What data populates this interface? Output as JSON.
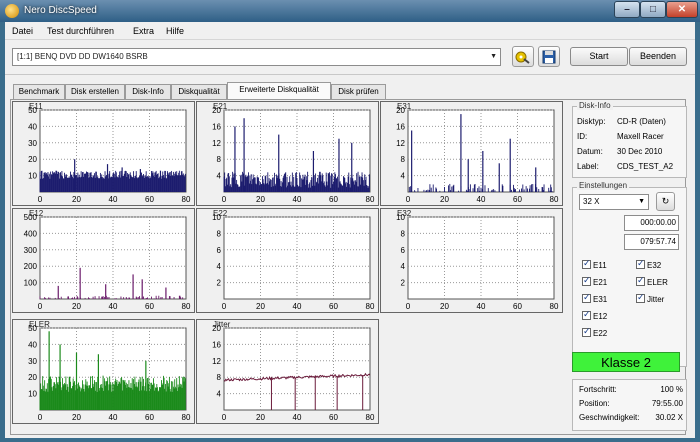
{
  "window": {
    "title": "Nero DiscSpeed",
    "min_glyph": "–",
    "max_glyph": "□",
    "close_glyph": "✕",
    "frame_color": "#3a6d8c"
  },
  "menu": [
    "Datei",
    "Test durchführen",
    "Extra",
    "Hilfe"
  ],
  "toolbar": {
    "drive": "[1:1]  BENQ DVD DD DW1640 BSRB",
    "start_label": "Start",
    "stop_label": "Beenden",
    "icon_names": [
      "drive-properties-icon",
      "save-icon"
    ]
  },
  "tabs": [
    "Benchmark",
    "Disk erstellen",
    "Disk-Info",
    "Diskqualität",
    "Erweiterte Diskqualität",
    "Disk prüfen"
  ],
  "active_tab": 4,
  "chart_data": [
    {
      "id": "e11",
      "type": "bar",
      "name": "E11",
      "color": "#1c1c6e",
      "ylim": [
        0,
        50
      ],
      "yticks": [
        10,
        20,
        30,
        40,
        50
      ],
      "xlim": [
        0,
        80
      ],
      "xticks": [
        0,
        20,
        40,
        60,
        80
      ],
      "base_level": 8,
      "level_variation": 5,
      "spikes": [
        [
          19,
          20
        ],
        [
          37,
          17
        ],
        [
          45,
          15
        ],
        [
          55,
          14
        ],
        [
          66,
          13
        ]
      ]
    },
    {
      "id": "e21",
      "type": "bar",
      "name": "E21",
      "color": "#1c1c6e",
      "ylim": [
        0,
        20
      ],
      "yticks": [
        4,
        8,
        12,
        16,
        20
      ],
      "xlim": [
        0,
        80
      ],
      "xticks": [
        0,
        20,
        40,
        60,
        80
      ],
      "base_level": 1,
      "level_variation": 4,
      "spikes": [
        [
          6,
          16
        ],
        [
          11,
          18
        ],
        [
          30,
          14
        ],
        [
          49,
          10
        ],
        [
          63,
          13
        ],
        [
          70,
          12
        ]
      ]
    },
    {
      "id": "e31",
      "type": "bar",
      "name": "E31",
      "color": "#1c1c6e",
      "ylim": [
        0,
        20
      ],
      "yticks": [
        4,
        8,
        12,
        16,
        20
      ],
      "xlim": [
        0,
        80
      ],
      "xticks": [
        0,
        20,
        40,
        60,
        80
      ],
      "base_level": 0,
      "level_variation": 2,
      "spikes": [
        [
          2,
          15
        ],
        [
          29,
          19
        ],
        [
          33,
          8
        ],
        [
          41,
          10
        ],
        [
          50,
          7
        ],
        [
          56,
          13
        ],
        [
          70,
          6
        ]
      ]
    },
    {
      "id": "e12",
      "type": "bar",
      "name": "E12",
      "color": "#6a1a6a",
      "ylim": [
        0,
        500
      ],
      "yticks": [
        100,
        200,
        300,
        400,
        500
      ],
      "xlim": [
        0,
        80
      ],
      "xticks": [
        0,
        20,
        40,
        60,
        80
      ],
      "base_level": 0,
      "level_variation": 20,
      "spikes": [
        [
          10,
          80
        ],
        [
          22,
          190
        ],
        [
          36,
          90
        ],
        [
          51,
          150
        ],
        [
          56,
          120
        ],
        [
          69,
          70
        ]
      ]
    },
    {
      "id": "e22",
      "type": "bar",
      "name": "E22",
      "color": "#6a1a6a",
      "ylim": [
        0,
        10
      ],
      "yticks": [
        2,
        4,
        6,
        8,
        10
      ],
      "xlim": [
        0,
        80
      ],
      "xticks": [
        0,
        20,
        40,
        60,
        80
      ],
      "base_level": 0,
      "level_variation": 0,
      "spikes": []
    },
    {
      "id": "e32",
      "type": "bar",
      "name": "E32",
      "color": "#6a1a6a",
      "ylim": [
        0,
        10
      ],
      "yticks": [
        2,
        4,
        6,
        8,
        10
      ],
      "xlim": [
        0,
        80
      ],
      "xticks": [
        0,
        20,
        40,
        60,
        80
      ],
      "base_level": 0,
      "level_variation": 0,
      "spikes": []
    },
    {
      "id": "eler",
      "type": "bar",
      "name": "ELER",
      "color": "#1b8a1b",
      "ylim": [
        0,
        50
      ],
      "yticks": [
        10,
        20,
        30,
        40,
        50
      ],
      "xlim": [
        0,
        80
      ],
      "xticks": [
        0,
        20,
        40,
        60,
        80
      ],
      "base_level": 11,
      "level_variation": 10,
      "spikes": [
        [
          5,
          48
        ],
        [
          11,
          40
        ],
        [
          20,
          35
        ],
        [
          32,
          34
        ],
        [
          58,
          30
        ]
      ]
    },
    {
      "id": "jitter",
      "type": "line",
      "name": "Jitter",
      "color": "#6a1a3a",
      "ylim": [
        0,
        20
      ],
      "yticks": [
        4,
        8,
        12,
        16,
        20
      ],
      "xlim": [
        0,
        80
      ],
      "xticks": [
        0,
        20,
        40,
        60,
        80
      ],
      "start_y": 7.3,
      "end_y": 8.6,
      "drops": [
        26,
        39,
        50,
        62,
        76
      ]
    }
  ],
  "disk_info": {
    "title": "Disk-Info",
    "rows": [
      {
        "label": "Disktyp:",
        "value": "CD-R (Daten)"
      },
      {
        "label": "ID:",
        "value": "Maxell Racer"
      },
      {
        "label": "Datum:",
        "value": "30 Dec 2010"
      },
      {
        "label": "Label:",
        "value": "CDS_TEST_A2"
      }
    ]
  },
  "settings": {
    "title": "Einstellungen",
    "speed": "32 X",
    "start_time": "000:00.00",
    "end_time": "079:57.74",
    "checkboxes": [
      {
        "label": "E11",
        "checked": true
      },
      {
        "label": "E32",
        "checked": true
      },
      {
        "label": "E21",
        "checked": true
      },
      {
        "label": "ELER",
        "checked": true
      },
      {
        "label": "E31",
        "checked": true
      },
      {
        "label": "Jitter",
        "checked": true
      },
      {
        "label": "E12",
        "checked": true
      },
      {
        "label": "E22",
        "checked": true
      }
    ]
  },
  "klasse": "Klasse 2",
  "status": [
    {
      "label": "Fortschritt:",
      "value": "100 %"
    },
    {
      "label": "Position:",
      "value": "79:55.00"
    },
    {
      "label": "Geschwindigkeit:",
      "value": "30.02 X"
    }
  ]
}
